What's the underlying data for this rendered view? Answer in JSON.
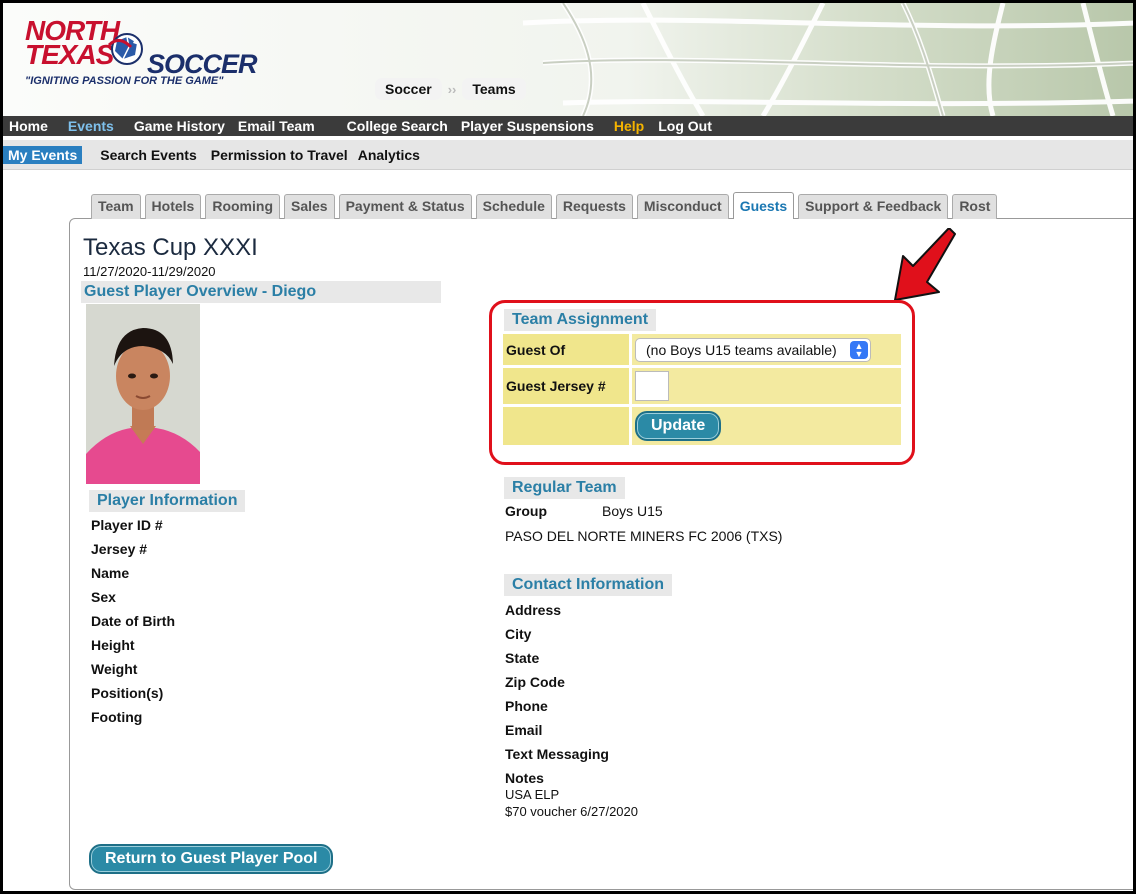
{
  "logo": {
    "line1": "NORTH",
    "line2": "TEXAS",
    "line3": "SOCCER",
    "tagline": "\"IGNITING PASSION FOR THE GAME\""
  },
  "breadcrumb": [
    "Soccer",
    "Teams"
  ],
  "main_nav": [
    "Home",
    "Events",
    "Game History",
    "Email Team",
    "College Search",
    "Player Suspensions",
    "Help",
    "Log Out"
  ],
  "sub_nav": [
    "My Events",
    "Search Events",
    "Permission to Travel",
    "Analytics"
  ],
  "tabs": [
    "Team",
    "Hotels",
    "Rooming",
    "Sales",
    "Payment & Status",
    "Schedule",
    "Requests",
    "Misconduct",
    "Guests",
    "Support & Feedback",
    "Rost"
  ],
  "active_tab": "Guests",
  "event": {
    "title": "Texas Cup XXXI",
    "dates": "11/27/2020-11/29/2020"
  },
  "guest_overview_heading": "Guest Player Overview - Diego",
  "player_info": {
    "heading": "Player Information",
    "fields": [
      "Player ID #",
      "Jersey #",
      "Name",
      "Sex",
      "Date of Birth",
      "Height",
      "Weight",
      "Position(s)",
      "Footing"
    ]
  },
  "team_assignment": {
    "heading": "Team Assignment",
    "guest_of_label": "Guest Of",
    "guest_of_value": "(no Boys U15 teams available)",
    "jersey_label": "Guest Jersey #",
    "jersey_value": "",
    "update_label": "Update"
  },
  "regular_team": {
    "heading": "Regular Team",
    "group_label": "Group",
    "group_value": "Boys U15",
    "team_name": "PASO DEL NORTE MINERS FC 2006 (TXS)"
  },
  "contact_info": {
    "heading": "Contact Information",
    "fields": [
      "Address",
      "City",
      "State",
      "Zip Code",
      "Phone",
      "Email",
      "Text Messaging",
      "Notes"
    ],
    "notes_lines": [
      "USA ELP",
      "$70 voucher 6/27/2020"
    ]
  },
  "return_button": "Return to Guest Player Pool",
  "colors": {
    "nav_bg": "#3b3b3b",
    "active_nav": "#7ec0ec",
    "help": "#f5b400",
    "section_heading": "#2b7fa6",
    "table_fill": "#f0e68c",
    "highlight": "#e0101b",
    "button": "#2b8aa6"
  }
}
